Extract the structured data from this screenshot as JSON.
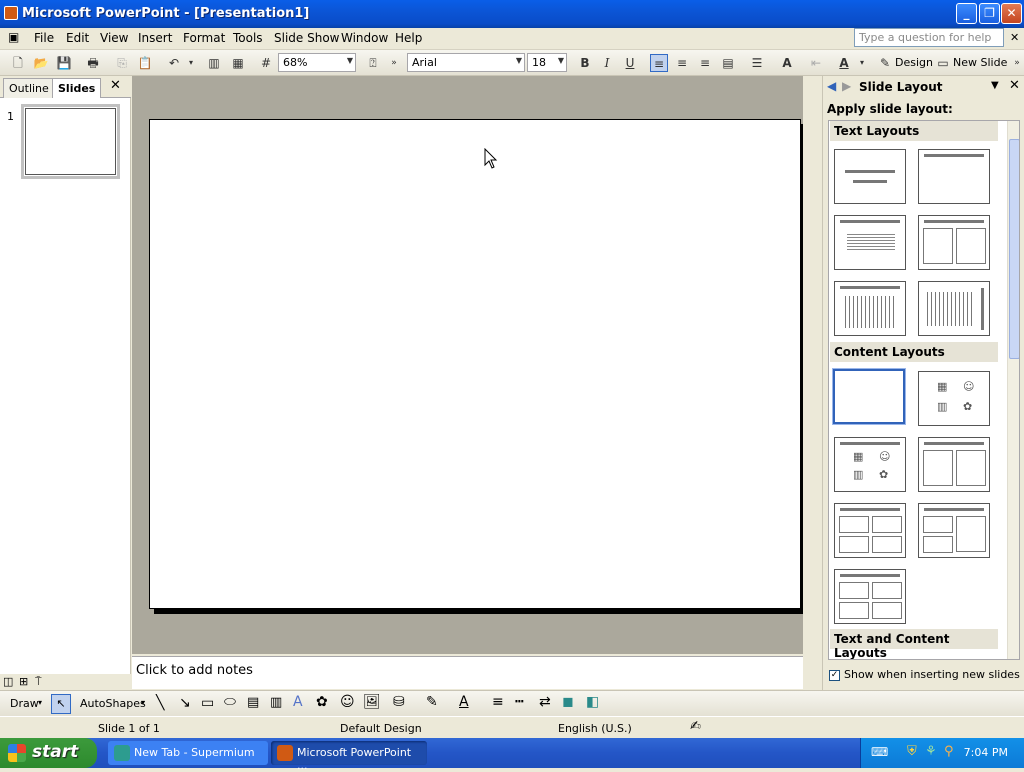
{
  "window": {
    "title": "Microsoft PowerPoint - [Presentation1]"
  },
  "menu": {
    "items": [
      "File",
      "Edit",
      "View",
      "Insert",
      "Format",
      "Tools",
      "Slide Show",
      "Window",
      "Help"
    ]
  },
  "ask_placeholder": "Type a question for help",
  "toolbar": {
    "zoom": "68%",
    "font": "Arial",
    "size": "18",
    "bold": "B",
    "italic": "I",
    "underline": "U",
    "design_label": "Design",
    "new_slide_label": "New Slide"
  },
  "left_pane": {
    "tabs": [
      "Outline",
      "Slides"
    ],
    "slide_number": "1"
  },
  "notes": {
    "placeholder": "Click to add notes"
  },
  "task_pane": {
    "title": "Slide Layout",
    "apply_label": "Apply slide layout:",
    "sections": [
      "Text Layouts",
      "Content Layouts",
      "Text and Content Layouts"
    ],
    "show_checkbox": "Show when inserting new slides"
  },
  "drawbar": {
    "draw_label": "Draw",
    "autoshapes_label": "AutoShapes"
  },
  "status": {
    "slide": "Slide 1 of 1",
    "design": "Default Design",
    "language": "English (U.S.)"
  },
  "taskbar": {
    "start": "start",
    "tasks": [
      "New Tab - Supermium",
      "Microsoft PowerPoint ..."
    ],
    "time": "7:04 PM"
  },
  "colors": {
    "titlebar": "#0b55d6",
    "workarea": "#aba89c",
    "selection": "#3163b9"
  }
}
